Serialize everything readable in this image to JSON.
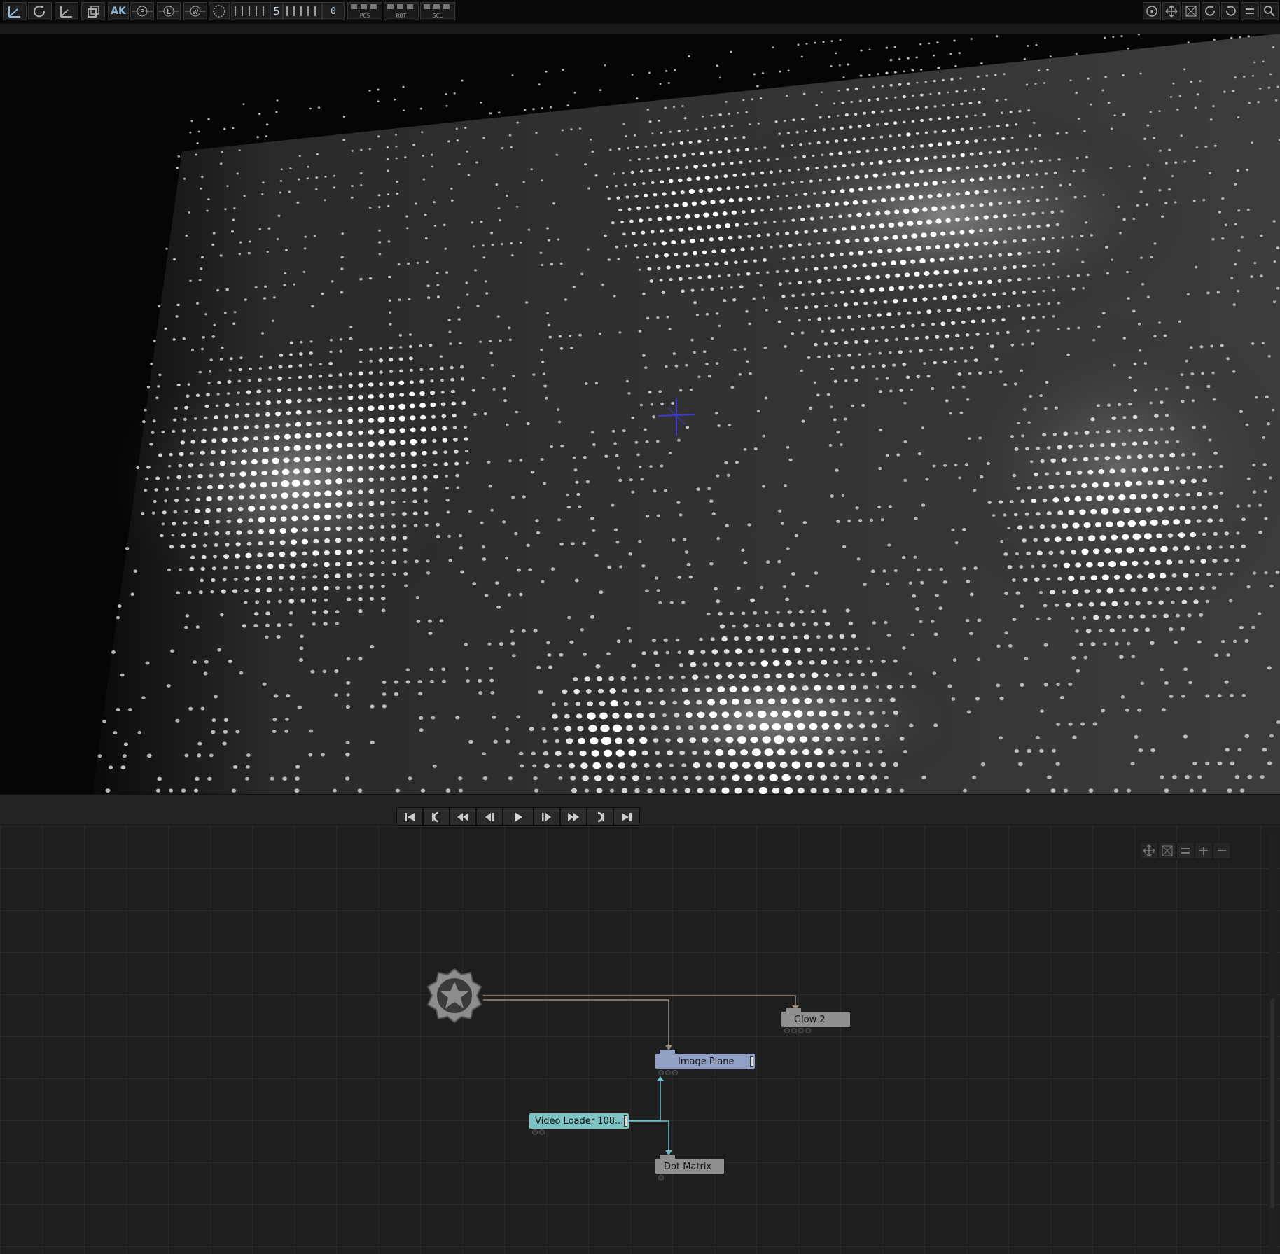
{
  "toolbar": {
    "left_tools": [
      {
        "icon": "axis-icon"
      },
      {
        "icon": "rotate-icon"
      },
      {
        "icon": "scale-axis-icon"
      },
      {
        "icon": "box-icon"
      },
      {
        "icon": "ak-icon",
        "label": "AK"
      },
      {
        "icon": "p-circle-icon",
        "label": "P"
      },
      {
        "icon": "l-circle-icon",
        "label": "L"
      },
      {
        "icon": "w-circle-icon",
        "label": "W"
      },
      {
        "icon": "dotted-circle-icon"
      }
    ],
    "counter_value": "5",
    "counter_tail": "0",
    "lock_groups": [
      {
        "label": "POS"
      },
      {
        "label": "ROT"
      },
      {
        "label": "SCL"
      }
    ],
    "right_tools": [
      {
        "icon": "target-icon"
      },
      {
        "icon": "move-icon"
      },
      {
        "icon": "fit-icon"
      },
      {
        "icon": "redo-icon"
      },
      {
        "icon": "undo-icon"
      },
      {
        "icon": "equals-icon"
      },
      {
        "icon": "search-icon"
      }
    ]
  },
  "viewport": {
    "content": "dot-matrix-render"
  },
  "transport": {
    "buttons": [
      {
        "icon": "skip-start-icon"
      },
      {
        "icon": "loop-back-icon"
      },
      {
        "icon": "rewind-icon"
      },
      {
        "icon": "step-back-icon"
      },
      {
        "icon": "play-icon"
      },
      {
        "icon": "step-forward-icon"
      },
      {
        "icon": "fast-forward-icon"
      },
      {
        "icon": "loop-forward-icon"
      },
      {
        "icon": "skip-end-icon"
      }
    ]
  },
  "graph_tools": [
    {
      "icon": "move-icon"
    },
    {
      "icon": "fit-icon"
    },
    {
      "icon": "equals-icon"
    },
    {
      "icon": "plus-icon"
    },
    {
      "icon": "minus-icon"
    }
  ],
  "nodes": {
    "glow": {
      "label": "Glow  2",
      "color": "#8f8f8f"
    },
    "image_plane": {
      "label": "Image  Plane",
      "color": "#8fa0c4"
    },
    "video_loader": {
      "label": "Video  Loader  108...",
      "color": "#7ec3c3"
    },
    "dot_matrix": {
      "label": "Dot  Matrix",
      "color": "#8f8f8f"
    }
  },
  "colors": {
    "wire_brown": "#9b8a7a",
    "wire_teal": "#6fc1c8",
    "crosshair": "#3a3acc"
  }
}
